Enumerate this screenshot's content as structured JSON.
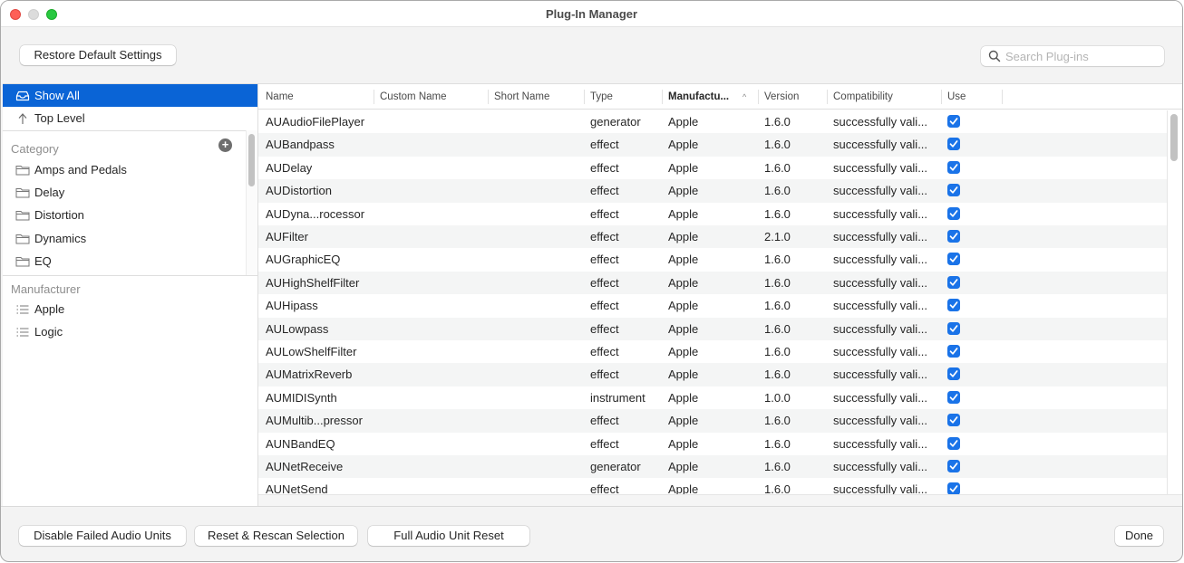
{
  "window": {
    "title": "Plug-In Manager"
  },
  "toolbar": {
    "restore_defaults_label": "Restore Default Settings",
    "search_placeholder": "Search Plug-ins",
    "search_value": ""
  },
  "sidebar": {
    "top_items": [
      {
        "label": "Show All",
        "icon": "tray-icon",
        "selected": true
      },
      {
        "label": "Top Level",
        "icon": "arrow-up-icon",
        "selected": false
      }
    ],
    "category_label": "Category",
    "categories": [
      {
        "label": "Amps and Pedals",
        "icon": "folder-icon"
      },
      {
        "label": "Delay",
        "icon": "folder-icon"
      },
      {
        "label": "Distortion",
        "icon": "folder-icon"
      },
      {
        "label": "Dynamics",
        "icon": "folder-icon"
      },
      {
        "label": "EQ",
        "icon": "folder-icon"
      }
    ],
    "manufacturer_label": "Manufacturer",
    "manufacturers": [
      {
        "label": "Apple",
        "icon": "list-icon"
      },
      {
        "label": "Logic",
        "icon": "list-icon"
      }
    ]
  },
  "table": {
    "columns": [
      "Name",
      "Custom Name",
      "Short Name",
      "Type",
      "Manufactu...",
      "Version",
      "Compatibility",
      "Use"
    ],
    "sorted_column": "Manufactu...",
    "sort_direction": "ascending",
    "rows": [
      {
        "name": "AUAudioFilePlayer",
        "custom_name": "",
        "short_name": "",
        "type": "generator",
        "manufacturer": "Apple",
        "version": "1.6.0",
        "compatibility": "successfully vali...",
        "use": true
      },
      {
        "name": "AUBandpass",
        "custom_name": "",
        "short_name": "",
        "type": "effect",
        "manufacturer": "Apple",
        "version": "1.6.0",
        "compatibility": "successfully vali...",
        "use": true
      },
      {
        "name": "AUDelay",
        "custom_name": "",
        "short_name": "",
        "type": "effect",
        "manufacturer": "Apple",
        "version": "1.6.0",
        "compatibility": "successfully vali...",
        "use": true
      },
      {
        "name": "AUDistortion",
        "custom_name": "",
        "short_name": "",
        "type": "effect",
        "manufacturer": "Apple",
        "version": "1.6.0",
        "compatibility": "successfully vali...",
        "use": true
      },
      {
        "name": "AUDyna...rocessor",
        "custom_name": "",
        "short_name": "",
        "type": "effect",
        "manufacturer": "Apple",
        "version": "1.6.0",
        "compatibility": "successfully vali...",
        "use": true
      },
      {
        "name": "AUFilter",
        "custom_name": "",
        "short_name": "",
        "type": "effect",
        "manufacturer": "Apple",
        "version": "2.1.0",
        "compatibility": "successfully vali...",
        "use": true
      },
      {
        "name": "AUGraphicEQ",
        "custom_name": "",
        "short_name": "",
        "type": "effect",
        "manufacturer": "Apple",
        "version": "1.6.0",
        "compatibility": "successfully vali...",
        "use": true
      },
      {
        "name": "AUHighShelfFilter",
        "custom_name": "",
        "short_name": "",
        "type": "effect",
        "manufacturer": "Apple",
        "version": "1.6.0",
        "compatibility": "successfully vali...",
        "use": true
      },
      {
        "name": "AUHipass",
        "custom_name": "",
        "short_name": "",
        "type": "effect",
        "manufacturer": "Apple",
        "version": "1.6.0",
        "compatibility": "successfully vali...",
        "use": true
      },
      {
        "name": "AULowpass",
        "custom_name": "",
        "short_name": "",
        "type": "effect",
        "manufacturer": "Apple",
        "version": "1.6.0",
        "compatibility": "successfully vali...",
        "use": true
      },
      {
        "name": "AULowShelfFilter",
        "custom_name": "",
        "short_name": "",
        "type": "effect",
        "manufacturer": "Apple",
        "version": "1.6.0",
        "compatibility": "successfully vali...",
        "use": true
      },
      {
        "name": "AUMatrixReverb",
        "custom_name": "",
        "short_name": "",
        "type": "effect",
        "manufacturer": "Apple",
        "version": "1.6.0",
        "compatibility": "successfully vali...",
        "use": true
      },
      {
        "name": "AUMIDISynth",
        "custom_name": "",
        "short_name": "",
        "type": "instrument",
        "manufacturer": "Apple",
        "version": "1.0.0",
        "compatibility": "successfully vali...",
        "use": true
      },
      {
        "name": "AUMultib...pressor",
        "custom_name": "",
        "short_name": "",
        "type": "effect",
        "manufacturer": "Apple",
        "version": "1.6.0",
        "compatibility": "successfully vali...",
        "use": true
      },
      {
        "name": "AUNBandEQ",
        "custom_name": "",
        "short_name": "",
        "type": "effect",
        "manufacturer": "Apple",
        "version": "1.6.0",
        "compatibility": "successfully vali...",
        "use": true
      },
      {
        "name": "AUNetReceive",
        "custom_name": "",
        "short_name": "",
        "type": "generator",
        "manufacturer": "Apple",
        "version": "1.6.0",
        "compatibility": "successfully vali...",
        "use": true
      },
      {
        "name": "AUNetSend",
        "custom_name": "",
        "short_name": "",
        "type": "effect",
        "manufacturer": "Apple",
        "version": "1.6.0",
        "compatibility": "successfully vali...",
        "use": true
      }
    ]
  },
  "footer": {
    "disable_failed_label": "Disable Failed Audio Units",
    "reset_rescan_label": "Reset & Rescan Selection",
    "full_reset_label": "Full Audio Unit Reset",
    "done_label": "Done"
  },
  "colors": {
    "selection": "#0a64d6",
    "checkbox": "#1a73e8",
    "close": "#fe5f57",
    "maximize": "#28c840"
  }
}
